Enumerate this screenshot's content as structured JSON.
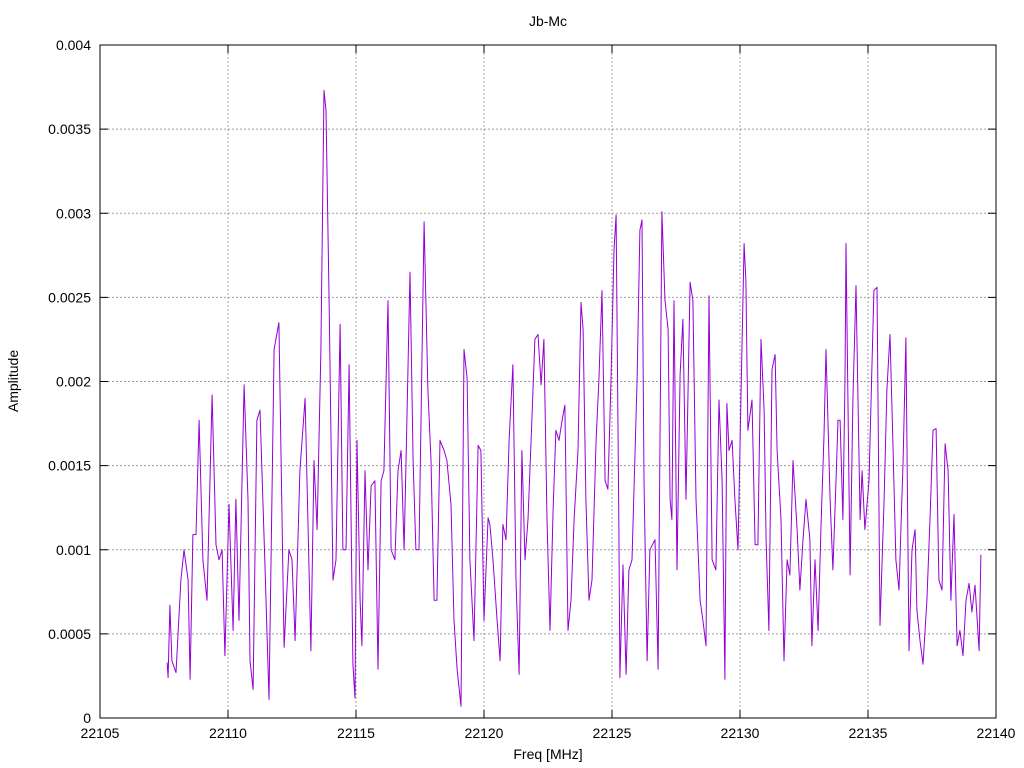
{
  "chart_data": {
    "type": "line",
    "title": "Jb-Mc",
    "xlabel": "Freq [MHz]",
    "ylabel": "Amplitude",
    "xlim": [
      22105,
      22140
    ],
    "ylim": [
      0,
      0.004
    ],
    "grid": true,
    "x_ticks": [
      "22105",
      "22110",
      "22115",
      "22120",
      "22125",
      "22130",
      "22135",
      "22140"
    ],
    "y_ticks": [
      "0",
      "0.0005",
      "0.001",
      "0.0015",
      "0.002",
      "0.0025",
      "0.003",
      "0.0035",
      "0.004"
    ],
    "series": [
      {
        "name": "Jb-Mc",
        "color": "#9400d3",
        "x": [
          22107.62,
          22107.66,
          22107.73,
          22107.81,
          22107.97,
          22108.16,
          22108.28,
          22108.44,
          22108.52,
          22108.63,
          22108.75,
          22108.87,
          22109.02,
          22109.18,
          22109.38,
          22109.53,
          22109.65,
          22109.77,
          22109.88,
          22110.04,
          22110.2,
          22110.31,
          22110.43,
          22110.63,
          22110.78,
          22110.86,
          22110.98,
          22111.13,
          22111.25,
          22111.45,
          22111.6,
          22111.8,
          22111.99,
          22112.19,
          22112.38,
          22112.5,
          22112.62,
          22112.81,
          22113.01,
          22113.24,
          22113.36,
          22113.48,
          22113.63,
          22113.75,
          22113.83,
          22113.95,
          22114.1,
          22114.22,
          22114.38,
          22114.49,
          22114.61,
          22114.73,
          22114.88,
          22114.96,
          22115.04,
          22115.16,
          22115.23,
          22115.35,
          22115.47,
          22115.59,
          22115.74,
          22115.86,
          22115.98,
          22116.09,
          22116.25,
          22116.37,
          22116.52,
          22116.64,
          22116.76,
          22116.88,
          22116.99,
          22117.11,
          22117.23,
          22117.34,
          22117.46,
          22117.66,
          22117.81,
          22117.93,
          22118.05,
          22118.16,
          22118.28,
          22118.44,
          22118.55,
          22118.71,
          22118.83,
          22118.95,
          22119.1,
          22119.22,
          22119.34,
          22119.45,
          22119.61,
          22119.77,
          22119.88,
          22120.0,
          22120.16,
          22120.23,
          22120.35,
          22120.51,
          22120.63,
          22120.74,
          22120.86,
          22120.98,
          22121.13,
          22121.25,
          22121.37,
          22121.48,
          22121.6,
          22121.72,
          22121.84,
          22121.99,
          22122.11,
          22122.23,
          22122.34,
          22122.46,
          22122.58,
          22122.7,
          22122.81,
          22122.93,
          22123.05,
          22123.16,
          22123.28,
          22123.4,
          22123.52,
          22123.67,
          22123.79,
          22123.87,
          22123.98,
          22124.1,
          22124.22,
          22124.38,
          22124.49,
          22124.61,
          22124.73,
          22124.84,
          22124.96,
          22125.08,
          22125.16,
          22125.27,
          22125.31,
          22125.43,
          22125.55,
          22125.66,
          22125.78,
          22125.98,
          22126.09,
          22126.17,
          22126.25,
          22126.37,
          22126.48,
          22126.68,
          22126.8,
          22126.95,
          22127.07,
          22127.19,
          22127.27,
          22127.34,
          22127.42,
          22127.54,
          22127.66,
          22127.77,
          22127.89,
          22128.05,
          22128.16,
          22128.28,
          22128.44,
          22128.55,
          22128.67,
          22128.79,
          22128.91,
          22129.06,
          22129.18,
          22129.3,
          22129.41,
          22129.49,
          22129.57,
          22129.69,
          22129.8,
          22129.92,
          22130.04,
          22130.16,
          22130.23,
          22130.31,
          22130.47,
          22130.59,
          22130.7,
          22130.82,
          22130.94,
          22131.02,
          22131.13,
          22131.25,
          22131.37,
          22131.45,
          22131.6,
          22131.72,
          22131.84,
          22131.95,
          22132.07,
          22132.23,
          22132.34,
          22132.46,
          22132.58,
          22132.73,
          22132.81,
          22132.93,
          22133.05,
          22133.16,
          22133.28,
          22133.36,
          22133.52,
          22133.63,
          22133.75,
          22133.83,
          22133.91,
          22134.02,
          22134.1,
          22134.14,
          22134.3,
          22134.41,
          22134.53,
          22134.69,
          22134.77,
          22134.88,
          22135.04,
          22135.23,
          22135.35,
          22135.47,
          22135.63,
          22135.74,
          22135.86,
          22135.98,
          22136.09,
          22136.21,
          22136.37,
          22136.48,
          22136.6,
          22136.72,
          22136.84,
          22136.91,
          22137.03,
          22137.15,
          22137.3,
          22137.42,
          22137.54,
          22137.66,
          22137.77,
          22137.89,
          22138.01,
          22138.13,
          22138.24,
          22138.36,
          22138.48,
          22138.59,
          22138.71,
          22138.83,
          22138.95,
          22139.06,
          22139.18,
          22139.34,
          22139.41
        ],
        "y": [
          0.00033,
          0.00024,
          0.00067,
          0.00034,
          0.00027,
          0.00082,
          0.001,
          0.00082,
          0.00023,
          0.00109,
          0.00109,
          0.00177,
          0.00094,
          0.0007,
          0.00192,
          0.00103,
          0.00094,
          0.001,
          0.00037,
          0.00127,
          0.00052,
          0.0013,
          0.00058,
          0.00198,
          0.0013,
          0.00034,
          0.00017,
          0.00177,
          0.00183,
          0.00088,
          0.00011,
          0.00219,
          0.00235,
          0.00042,
          0.001,
          0.00094,
          0.00046,
          0.00147,
          0.0019,
          0.0004,
          0.00153,
          0.00112,
          0.00219,
          0.00373,
          0.00361,
          0.00248,
          0.00082,
          0.00094,
          0.00234,
          0.001,
          0.001,
          0.0021,
          0.00032,
          0.00012,
          0.00165,
          0.0007,
          0.00043,
          0.00147,
          0.00088,
          0.00138,
          0.00141,
          0.00029,
          0.00141,
          0.00147,
          0.00248,
          0.001,
          0.00094,
          0.00147,
          0.00159,
          0.001,
          0.00177,
          0.00265,
          0.00153,
          0.001,
          0.001,
          0.00295,
          0.00195,
          0.00153,
          0.0007,
          0.0007,
          0.00165,
          0.00159,
          0.00153,
          0.00127,
          0.00058,
          0.00029,
          7e-05,
          0.00219,
          0.00202,
          0.00094,
          0.00046,
          0.00162,
          0.00159,
          0.00058,
          0.00119,
          0.00115,
          0.00094,
          0.00058,
          0.00034,
          0.00115,
          0.00106,
          0.00165,
          0.0021,
          0.00082,
          0.00026,
          0.00159,
          0.00094,
          0.00118,
          0.00165,
          0.00225,
          0.00228,
          0.00198,
          0.00225,
          0.00118,
          0.00052,
          0.00124,
          0.00171,
          0.00165,
          0.00177,
          0.00186,
          0.00052,
          0.0007,
          0.00118,
          0.00159,
          0.00247,
          0.00231,
          0.0013,
          0.0007,
          0.00082,
          0.00165,
          0.00201,
          0.00254,
          0.00141,
          0.00136,
          0.00201,
          0.00278,
          0.00299,
          0.00112,
          0.00024,
          0.00091,
          0.00026,
          0.00088,
          0.00094,
          0.00201,
          0.0029,
          0.00296,
          0.00141,
          0.00034,
          0.001,
          0.00106,
          0.00029,
          0.00301,
          0.00248,
          0.00231,
          0.0013,
          0.00118,
          0.00248,
          0.00088,
          0.00204,
          0.00237,
          0.0013,
          0.00259,
          0.00248,
          0.0013,
          0.0007,
          0.00058,
          0.00043,
          0.00251,
          0.00094,
          0.00088,
          0.00189,
          0.00141,
          0.00023,
          0.00187,
          0.00159,
          0.00165,
          0.0013,
          0.001,
          0.00192,
          0.00282,
          0.0026,
          0.00171,
          0.00189,
          0.00103,
          0.00103,
          0.00225,
          0.00183,
          0.00106,
          0.00052,
          0.00207,
          0.00216,
          0.00159,
          0.00118,
          0.00034,
          0.00094,
          0.00085,
          0.00153,
          0.00112,
          0.00076,
          0.00106,
          0.0013,
          0.00106,
          0.00043,
          0.00094,
          0.00052,
          0.00112,
          0.00168,
          0.00219,
          0.0013,
          0.00088,
          0.00141,
          0.00177,
          0.00177,
          0.00118,
          0.00201,
          0.00282,
          0.00085,
          0.00189,
          0.00257,
          0.00118,
          0.00147,
          0.00112,
          0.00141,
          0.00254,
          0.00256,
          0.00055,
          0.0013,
          0.00195,
          0.00228,
          0.00159,
          0.00094,
          0.00076,
          0.00153,
          0.00226,
          0.0004,
          0.001,
          0.00112,
          0.00064,
          0.00046,
          0.00032,
          0.0007,
          0.00118,
          0.00171,
          0.00172,
          0.00082,
          0.00076,
          0.00163,
          0.00147,
          0.0007,
          0.00121,
          0.00043,
          0.00052,
          0.00037,
          0.0007,
          0.0008,
          0.00063,
          0.00079,
          0.0004,
          0.00097
        ]
      }
    ]
  }
}
